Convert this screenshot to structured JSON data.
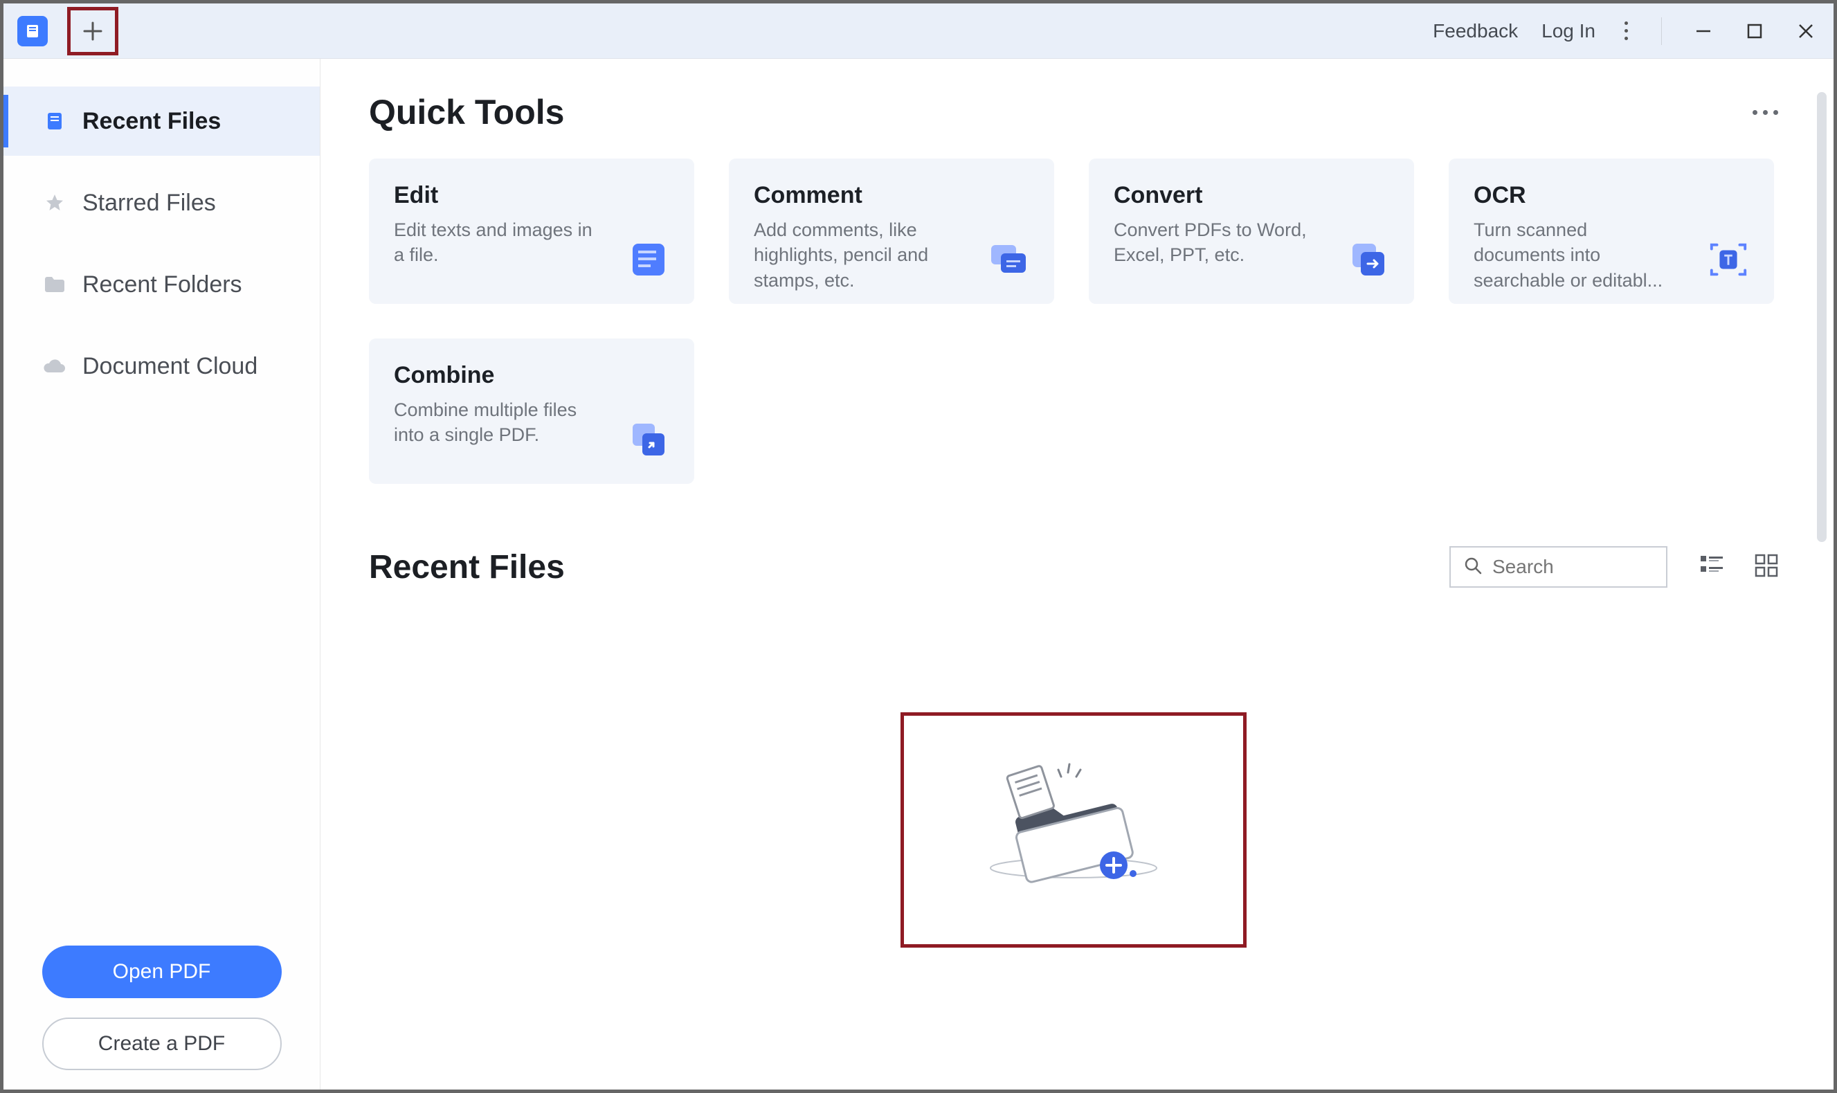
{
  "titlebar": {
    "feedback": "Feedback",
    "login": "Log In"
  },
  "sidebar": {
    "items": [
      {
        "label": "Recent Files"
      },
      {
        "label": "Starred Files"
      },
      {
        "label": "Recent Folders"
      },
      {
        "label": "Document Cloud"
      }
    ],
    "open_btn": "Open PDF",
    "create_btn": "Create a PDF"
  },
  "main": {
    "quicktools_title": "Quick Tools",
    "cards": [
      {
        "title": "Edit",
        "desc": "Edit texts and images in a file."
      },
      {
        "title": "Comment",
        "desc": "Add comments, like highlights, pencil and stamps, etc."
      },
      {
        "title": "Convert",
        "desc": "Convert PDFs to Word, Excel, PPT, etc."
      },
      {
        "title": "OCR",
        "desc": "Turn scanned documents into searchable or editabl..."
      },
      {
        "title": "Combine",
        "desc": "Combine multiple files into a single PDF."
      }
    ],
    "recent_title": "Recent Files",
    "search_placeholder": "Search"
  }
}
